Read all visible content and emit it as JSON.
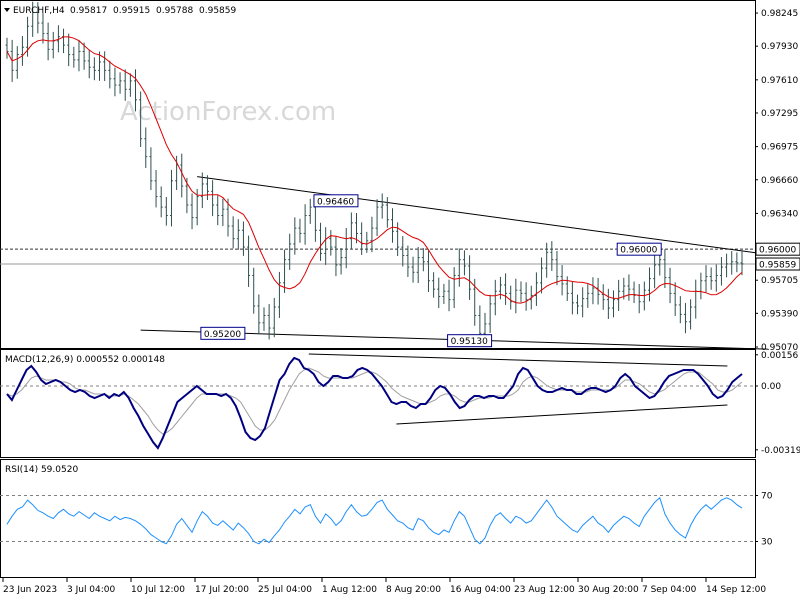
{
  "header": {
    "symbol": "EURCHF,H4",
    "open": "0.95817",
    "high": "0.95915",
    "low": "0.95788",
    "close": "0.95859"
  },
  "watermark": "ActionForex.com",
  "colors": {
    "candle": "#2f4f4f",
    "sma": "#dd0000",
    "macd": "#000080",
    "signal": "#a0a0a0",
    "rsi": "#1e90ff",
    "grid": "#808080",
    "trendline": "#000000"
  },
  "chart_data": [
    {
      "type": "candlestick",
      "ylim": [
        0.9507,
        0.9835
      ],
      "yticks": [
        "0.98245",
        "0.97930",
        "0.97610",
        "0.97295",
        "0.96975",
        "0.96660",
        "0.96340",
        "0.95705",
        "0.95390",
        "0.95070"
      ],
      "price_labels": [
        {
          "text": "0.96000",
          "value": 0.96
        },
        {
          "text": "0.95859",
          "value": 0.95859
        }
      ],
      "xlabels": [
        "23 Jun 2023",
        "3 Jul 04:00",
        "10 Jul 12:00",
        "17 Jul 20:00",
        "25 Jul 04:00",
        "1 Aug 12:00",
        "8 Aug 20:00",
        "16 Aug 04:00",
        "23 Aug 12:00",
        "30 Aug 20:00",
        "7 Sep 04:00",
        "14 Sep 12:00"
      ],
      "annotations": [
        {
          "text": "0.96460",
          "index": 64,
          "value": 0.9646
        },
        {
          "text": "0.95200",
          "index": 42,
          "value": 0.952
        },
        {
          "text": "0.95130",
          "index": 90,
          "value": 0.9513
        },
        {
          "text": "0.96000",
          "index": 123,
          "value": 0.96
        }
      ],
      "hlines": [
        0.96,
        0.95859
      ],
      "trendlines": [
        {
          "from": [
            37,
            0.9669
          ],
          "to": [
            148,
            0.9595
          ]
        },
        {
          "from": [
            26,
            0.9523
          ],
          "to": [
            148,
            0.9505
          ]
        }
      ],
      "closes": [
        0.9788,
        0.977,
        0.9785,
        0.9792,
        0.9812,
        0.9825,
        0.9815,
        0.9805,
        0.979,
        0.9798,
        0.9802,
        0.9794,
        0.9785,
        0.978,
        0.9788,
        0.9779,
        0.9773,
        0.977,
        0.9778,
        0.977,
        0.9762,
        0.9756,
        0.976,
        0.9752,
        0.976,
        0.9742,
        0.9705,
        0.9688,
        0.9665,
        0.965,
        0.964,
        0.9632,
        0.9665,
        0.968,
        0.966,
        0.9642,
        0.963,
        0.965,
        0.9662,
        0.9655,
        0.9642,
        0.9632,
        0.9638,
        0.9622,
        0.961,
        0.9618,
        0.9602,
        0.9575,
        0.9546,
        0.953,
        0.9537,
        0.9525,
        0.9545,
        0.9568,
        0.959,
        0.9605,
        0.962,
        0.9615,
        0.9632,
        0.964,
        0.9618,
        0.9596,
        0.961,
        0.9602,
        0.9585,
        0.9592,
        0.961,
        0.9625,
        0.9615,
        0.9605,
        0.9608,
        0.962,
        0.964,
        0.9642,
        0.9628,
        0.9617,
        0.9602,
        0.9594,
        0.9583,
        0.9578,
        0.9592,
        0.9588,
        0.957,
        0.9562,
        0.9555,
        0.956,
        0.9552,
        0.9575,
        0.959,
        0.9584,
        0.9562,
        0.9537,
        0.952,
        0.9529,
        0.9548,
        0.956,
        0.9566,
        0.9558,
        0.955,
        0.9561,
        0.9558,
        0.9552,
        0.9556,
        0.9568,
        0.9582,
        0.9597,
        0.959,
        0.9574,
        0.9567,
        0.9558,
        0.9549,
        0.9546,
        0.9553,
        0.9558,
        0.9563,
        0.9557,
        0.9552,
        0.9544,
        0.9552,
        0.956,
        0.9565,
        0.9562,
        0.9556,
        0.955,
        0.9561,
        0.9572,
        0.9585,
        0.959,
        0.9573,
        0.9558,
        0.9547,
        0.9538,
        0.9531,
        0.9545,
        0.956,
        0.957,
        0.9574,
        0.957,
        0.9575,
        0.9583,
        0.9586,
        0.9588,
        0.9587,
        0.9586
      ]
    },
    {
      "type": "line",
      "title": "MACD(12,26,9) 0.000552 0.000148",
      "ylim": [
        -0.0035,
        0.00175
      ],
      "yticks": [
        "0.00156",
        "0.00",
        "-0.00319"
      ],
      "trendlines": [
        {
          "from": [
            62,
            0.0016
          ],
          "to": [
            148,
            0.001
          ]
        },
        {
          "from": [
            80,
            -0.0019
          ],
          "to": [
            148,
            -0.00095
          ]
        }
      ],
      "macd": [
        -0.0004,
        -0.0007,
        -0.0002,
        0.0003,
        0.0008,
        0.001,
        0.0007,
        0.0003,
        0.0001,
        0.0002,
        0.0003,
        0.0002,
        0.0,
        -0.0002,
        -0.0003,
        -0.0002,
        -0.0003,
        -0.0005,
        -0.0006,
        -0.0005,
        -0.0004,
        -0.0006,
        -0.0004,
        -0.0005,
        -0.0003,
        -0.0006,
        -0.0011,
        -0.0015,
        -0.002,
        -0.0024,
        -0.0028,
        -0.0031,
        -0.0026,
        -0.002,
        -0.0014,
        -0.0008,
        -0.0006,
        -0.0004,
        -0.0002,
        0.0,
        -0.0002,
        -0.0004,
        -0.0004,
        -0.0004,
        -0.0005,
        -0.0004,
        -0.0006,
        -0.001,
        -0.0016,
        -0.0023,
        -0.0026,
        -0.0027,
        -0.0025,
        -0.0021,
        -0.0013,
        -0.0005,
        0.0003,
        0.0006,
        0.0011,
        0.0014,
        0.0013,
        0.0009,
        0.0008,
        0.0006,
        0.0002,
        0.0,
        0.0002,
        0.0005,
        0.0005,
        0.0004,
        0.0004,
        0.0005,
        0.0008,
        0.0009,
        0.0008,
        0.0006,
        0.0003,
        0.0,
        -0.0004,
        -0.0008,
        -0.0009,
        -0.0008,
        -0.0008,
        -0.001,
        -0.0011,
        -0.0009,
        -0.0009,
        -0.0006,
        -0.0002,
        0.0,
        -0.0001,
        -0.0004,
        -0.0008,
        -0.0011,
        -0.001,
        -0.0007,
        -0.0005,
        -0.0005,
        -0.0006,
        -0.0005,
        -0.0005,
        -0.0006,
        -0.0006,
        -0.0003,
        0.0,
        0.0006,
        0.0009,
        0.0008,
        0.0004,
        0.0,
        -0.0002,
        -0.0003,
        -0.0003,
        -0.0002,
        -0.0001,
        -0.0002,
        -0.0002,
        -0.0004,
        -0.0004,
        -0.0002,
        -0.0001,
        -0.0001,
        -0.0002,
        -0.0003,
        -0.0002,
        0.0,
        0.0004,
        0.0006,
        0.0004,
        0.0,
        -0.0002,
        -0.0004,
        -0.0006,
        -0.0005,
        -0.0002,
        0.0002,
        0.0005,
        0.0006,
        0.0007,
        0.0008,
        0.0008,
        0.0008,
        0.0006,
        0.0003,
        0.0,
        -0.0004,
        -0.0006,
        -0.0005,
        -0.0002,
        0.0002,
        0.0004,
        0.0006
      ],
      "signal": [
        -0.0004,
        -0.0005,
        -0.0004,
        -0.0002,
        0.0001,
        0.0004,
        0.0005,
        0.0004,
        0.0003,
        0.0003,
        0.0003,
        0.0002,
        0.0002,
        0.0001,
        -0.0001,
        -0.0002,
        -0.0002,
        -0.0003,
        -0.0004,
        -0.0004,
        -0.0004,
        -0.0005,
        -0.0005,
        -0.0005,
        -0.0004,
        -0.0005,
        -0.0007,
        -0.0009,
        -0.0012,
        -0.0015,
        -0.0019,
        -0.0022,
        -0.0024,
        -0.0023,
        -0.0021,
        -0.0018,
        -0.0015,
        -0.0012,
        -0.0009,
        -0.0006,
        -0.0004,
        -0.0004,
        -0.0004,
        -0.0004,
        -0.0004,
        -0.0004,
        -0.0005,
        -0.0006,
        -0.0008,
        -0.0012,
        -0.0016,
        -0.002,
        -0.0022,
        -0.0022,
        -0.002,
        -0.0017,
        -0.0012,
        -0.0007,
        -0.0002,
        0.0002,
        0.0006,
        0.0008,
        0.0009,
        0.0008,
        0.0007,
        0.0005,
        0.0004,
        0.0004,
        0.0004,
        0.0004,
        0.0004,
        0.0004,
        0.0005,
        0.0006,
        0.0007,
        0.0007,
        0.0006,
        0.0004,
        0.0002,
        -0.0001,
        -0.0003,
        -0.0005,
        -0.0006,
        -0.0007,
        -0.0008,
        -0.0009,
        -0.0009,
        -0.0008,
        -0.0007,
        -0.0005,
        -0.0004,
        -0.0004,
        -0.0005,
        -0.0007,
        -0.0008,
        -0.0008,
        -0.0007,
        -0.0006,
        -0.0006,
        -0.0006,
        -0.0005,
        -0.0005,
        -0.0005,
        -0.0005,
        -0.0004,
        -0.0002,
        0.0002,
        0.0004,
        0.0005,
        0.0004,
        0.0002,
        0.0,
        -0.0001,
        -0.0002,
        -0.0002,
        -0.0002,
        -0.0002,
        -0.0003,
        -0.0003,
        -0.0003,
        -0.0002,
        -0.0002,
        -0.0002,
        -0.0002,
        -0.0002,
        -0.0001,
        0.0001,
        0.0003,
        0.0003,
        0.0002,
        0.0001,
        -0.0001,
        -0.0003,
        -0.0004,
        -0.0003,
        -0.0002,
        0.0,
        0.0002,
        0.0004,
        0.0006,
        0.0007,
        0.0007,
        0.0007,
        0.0005,
        0.0003,
        0.0001,
        -0.0002,
        -0.0003,
        -0.0003,
        -0.0002,
        0.0,
        0.0002
      ]
    },
    {
      "type": "line",
      "title": "RSI(14) 59.0520",
      "ylim": [
        0,
        100
      ],
      "yticks": [
        "70",
        "30"
      ],
      "levels": [
        70,
        30
      ],
      "values": [
        45,
        52,
        58,
        60,
        66,
        62,
        57,
        55,
        52,
        50,
        55,
        58,
        54,
        52,
        56,
        53,
        50,
        55,
        52,
        50,
        48,
        52,
        49,
        51,
        50,
        48,
        45,
        41,
        36,
        33,
        30,
        28,
        35,
        45,
        50,
        44,
        38,
        48,
        56,
        52,
        46,
        44,
        48,
        44,
        40,
        46,
        42,
        37,
        30,
        28,
        32,
        29,
        35,
        40,
        47,
        52,
        58,
        54,
        60,
        62,
        52,
        46,
        54,
        50,
        44,
        48,
        56,
        62,
        56,
        52,
        53,
        58,
        64,
        66,
        58,
        53,
        48,
        46,
        42,
        40,
        50,
        48,
        42,
        38,
        36,
        40,
        38,
        48,
        56,
        52,
        42,
        32,
        28,
        33,
        44,
        52,
        55,
        50,
        46,
        52,
        50,
        46,
        48,
        54,
        60,
        66,
        60,
        52,
        48,
        44,
        40,
        38,
        44,
        48,
        52,
        46,
        43,
        38,
        44,
        48,
        52,
        50,
        46,
        43,
        52,
        58,
        64,
        68,
        54,
        46,
        40,
        36,
        33,
        44,
        52,
        58,
        62,
        58,
        62,
        66,
        68,
        66,
        62,
        59
      ]
    }
  ]
}
